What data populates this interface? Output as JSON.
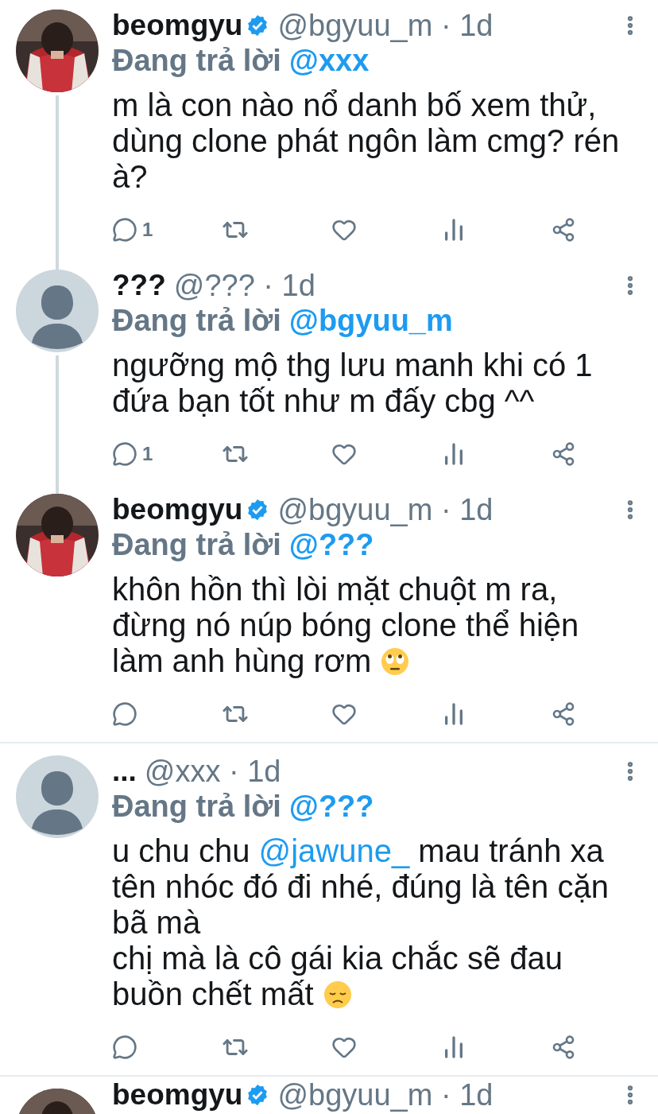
{
  "tweets": [
    {
      "kind": "photo_avatar",
      "name": "beomgyu",
      "verified": true,
      "meta": "@bgyuu_m · 1d",
      "replying_label": "Đang trả lời",
      "replying_to": "@xxx",
      "thread_below": true,
      "lines": [
        [
          {
            "kind": "text",
            "text": "m là con nào nổ danh bố xem thử,"
          }
        ],
        [
          {
            "kind": "text",
            "text": "dùng clone phát ngôn làm cmg? rén"
          }
        ],
        [
          {
            "kind": "text",
            "text": "à?"
          }
        ]
      ],
      "reply_count": "1"
    },
    {
      "kind": "default_avatar",
      "name": "???",
      "verified": false,
      "meta": "@??? · 1d",
      "replying_label": "Đang trả lời",
      "replying_to": "@bgyuu_m",
      "thread_below": true,
      "lines": [
        [
          {
            "kind": "text",
            "text": "ngưỡng mộ thg lưu manh khi có 1"
          }
        ],
        [
          {
            "kind": "text",
            "text": "đứa bạn tốt như m đấy cbg ^^"
          }
        ]
      ],
      "reply_count": "1"
    },
    {
      "kind": "photo_avatar",
      "name": "beomgyu",
      "verified": true,
      "meta": "@bgyuu_m · 1d",
      "replying_label": "Đang trả lời",
      "replying_to": "@???",
      "thread_below": false,
      "lines": [
        [
          {
            "kind": "text",
            "text": "khôn hồn thì lòi mặt chuột m ra,"
          }
        ],
        [
          {
            "kind": "text",
            "text": "đừng nó núp bóng clone thể hiện"
          }
        ],
        [
          {
            "kind": "text",
            "text": "làm anh hùng rơm"
          },
          {
            "kind": "emoji_rolling_eyes"
          }
        ]
      ]
    },
    {
      "kind": "default_avatar",
      "name": "...",
      "verified": false,
      "meta": "@xxx · 1d",
      "replying_label": "Đang trả lời",
      "replying_to": "@???",
      "thread_below": false,
      "lines": [
        [
          {
            "kind": "text",
            "text": "u chu chu "
          },
          {
            "kind": "mention",
            "text": "@jawune_"
          },
          {
            "kind": "text",
            "text": " mau tránh xa"
          }
        ],
        [
          {
            "kind": "text",
            "text": "tên nhóc đó đi nhé, đúng là tên cặn"
          }
        ],
        [
          {
            "kind": "text",
            "text": "bã mà"
          }
        ],
        [
          {
            "kind": "text",
            "text": "chị mà là cô gái kia chắc sẽ đau"
          }
        ],
        [
          {
            "kind": "text",
            "text": "buồn chết mất"
          },
          {
            "kind": "emoji_sad"
          }
        ]
      ]
    },
    {
      "kind": "photo_avatar",
      "name": "beomgyu",
      "verified": true,
      "meta": "@bgyuu_m · 1d",
      "thread_below": false
    }
  ]
}
